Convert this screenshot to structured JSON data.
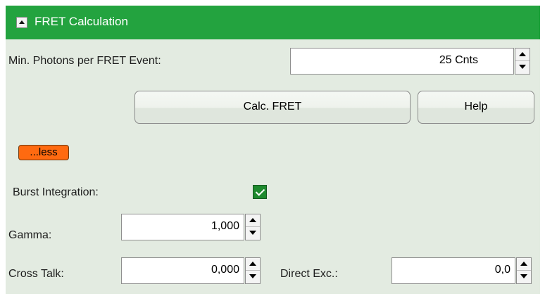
{
  "panel": {
    "title": "FRET Calculation",
    "min_photons": {
      "label": "Min. Photons per FRET Event:",
      "value": "25 Cnts"
    },
    "calc_button": "Calc. FRET",
    "help_button": "Help",
    "less_button": "...less",
    "burst_integration": {
      "label": "Burst Integration:",
      "checked": true
    },
    "gamma": {
      "label": "Gamma:",
      "value": "1,000"
    },
    "cross_talk": {
      "label": "Cross Talk:",
      "value": "0,000"
    },
    "direct_exc": {
      "label": "Direct Exc.:",
      "value": "0,0"
    }
  },
  "colors": {
    "header": "#23a33f",
    "panel_bg": "#e3ebe1",
    "less_button": "#ff6a10",
    "checkbox": "#1e8a2e"
  }
}
